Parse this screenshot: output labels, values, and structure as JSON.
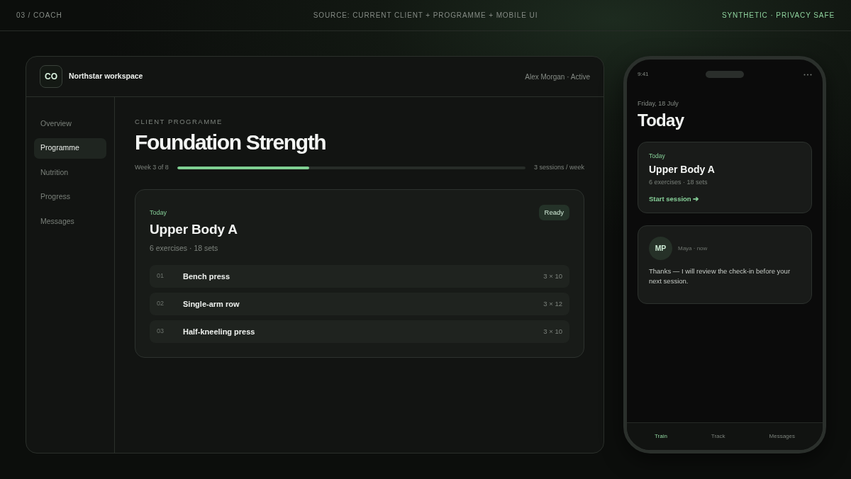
{
  "top_bar": {
    "left": "03 / COACH",
    "center": "SOURCE: CURRENT CLIENT + PROGRAMME + MOBILE UI",
    "right": "SYNTHETIC · PRIVACY SAFE"
  },
  "desktop": {
    "header": {
      "logo": "CO",
      "workspace": "Northstar workspace",
      "user_status": "Alex Morgan · Active"
    },
    "sidebar": {
      "items": [
        {
          "label": "Overview",
          "selected": false
        },
        {
          "label": "Programme",
          "selected": true
        },
        {
          "label": "Nutrition",
          "selected": false
        },
        {
          "label": "Progress",
          "selected": false
        },
        {
          "label": "Messages",
          "selected": false
        }
      ]
    },
    "main": {
      "eyebrow": "CLIENT PROGRAMME",
      "title": "Foundation Strength",
      "progress": {
        "label": "Week 3 of 8",
        "level": 0.38,
        "reading": "3 sessions / week"
      },
      "session_card": {
        "tag": "Today",
        "title": "Upper Body A",
        "badge": "Ready",
        "summary": "6 exercises · 18 sets",
        "exercises": [
          {
            "number": "01",
            "name": "Bench press",
            "sets": "3 × 10"
          },
          {
            "number": "02",
            "name": "Single-arm row",
            "sets": "3 × 12"
          },
          {
            "number": "03",
            "name": "Half-kneeling press",
            "sets": "3 × 10"
          }
        ]
      }
    }
  },
  "phone": {
    "status_bar": {
      "time": "9:41"
    },
    "date": "Friday, 18 July",
    "heading": "Today",
    "session_card": {
      "tag": "Today",
      "title": "Upper Body A",
      "summary": "6 exercises · 18 sets",
      "action": "Start session ➔"
    },
    "message_card": {
      "avatar": "MP",
      "meta": "Maya · now",
      "text": "Thanks — I will review the check-in before your next session."
    },
    "tab_bar": [
      {
        "label": "Train",
        "selected": true
      },
      {
        "label": "Track",
        "selected": false
      },
      {
        "label": "Messages",
        "selected": false
      }
    ]
  }
}
